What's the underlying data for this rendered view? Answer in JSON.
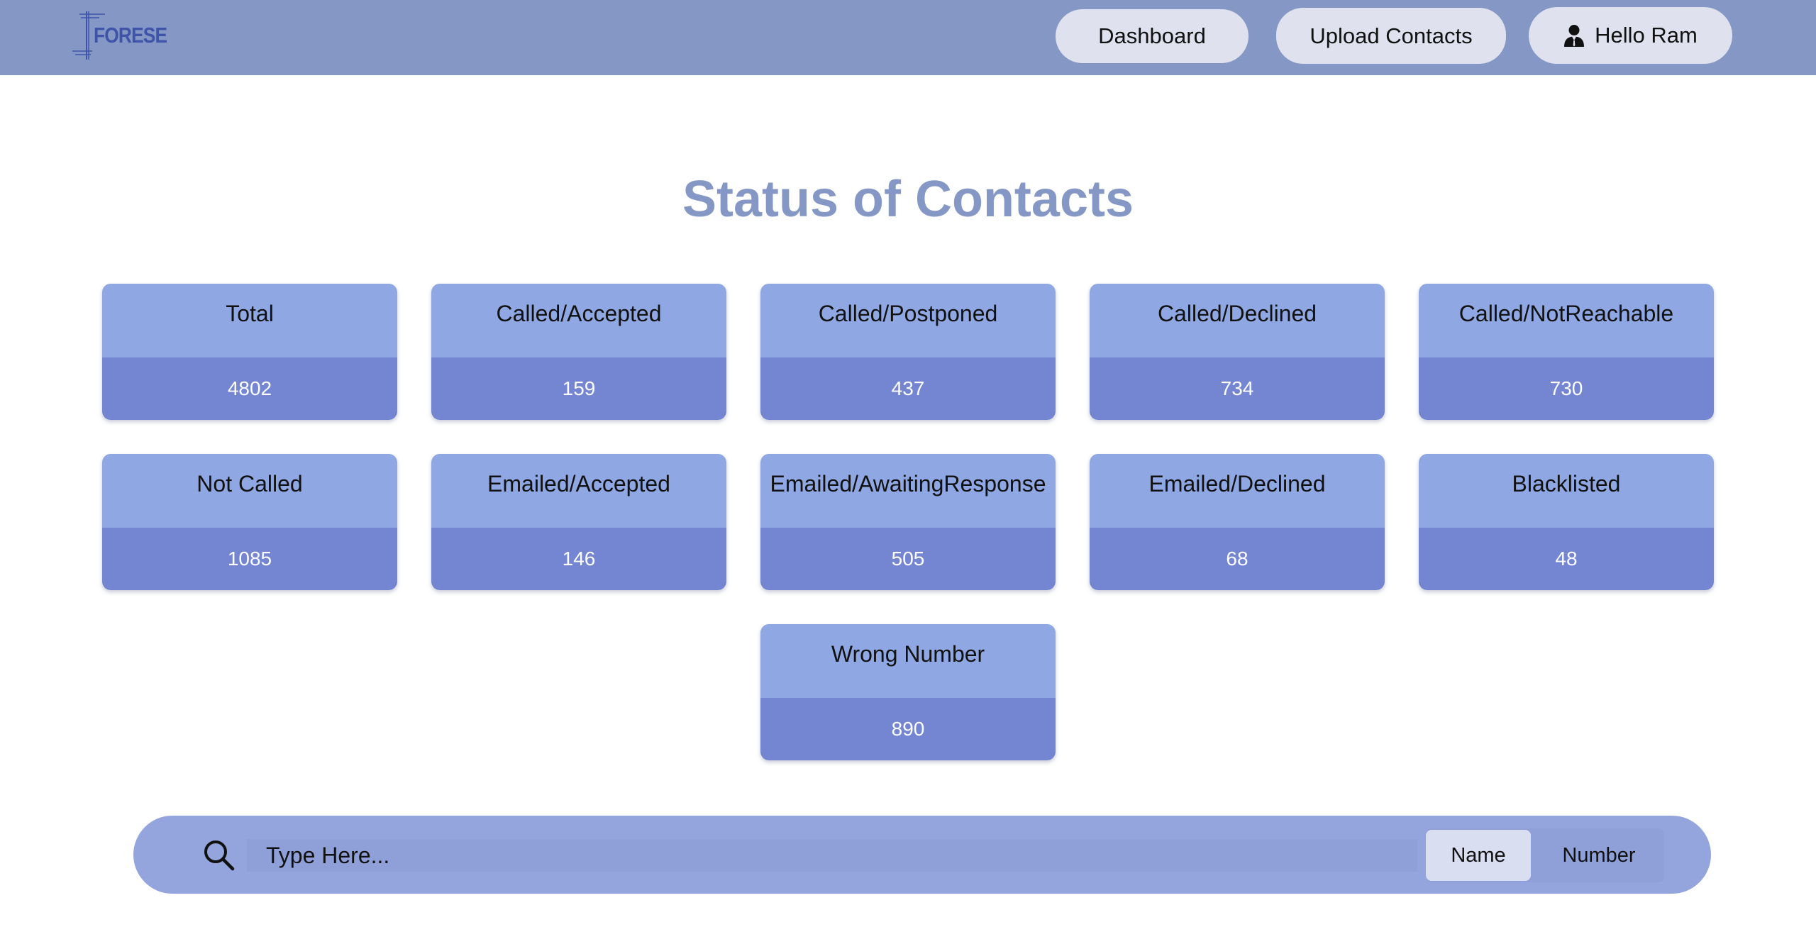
{
  "brand": {
    "logo_text": "FORESE"
  },
  "nav": {
    "dashboard_label": "Dashboard",
    "upload_label": "Upload Contacts",
    "user_label": "Hello Ram",
    "user_icon": "user-icon"
  },
  "page": {
    "title": "Status of Contacts"
  },
  "cards": [
    {
      "label": "Total",
      "value": "4802"
    },
    {
      "label": "Called/Accepted",
      "value": "159"
    },
    {
      "label": "Called/Postponed",
      "value": "437"
    },
    {
      "label": "Called/Declined",
      "value": "734"
    },
    {
      "label": "Called/NotReachable",
      "value": "730"
    },
    {
      "label": "Not Called",
      "value": "1085"
    },
    {
      "label": "Emailed/Accepted",
      "value": "146"
    },
    {
      "label": "Emailed/AwaitingResponse",
      "value": "505"
    },
    {
      "label": "Emailed/Declined",
      "value": "68"
    },
    {
      "label": "Blacklisted",
      "value": "48"
    },
    {
      "label": "Wrong Number",
      "value": "890"
    }
  ],
  "search": {
    "icon": "search-icon",
    "placeholder": "Type Here...",
    "value": "",
    "modes": [
      "Name",
      "Number"
    ],
    "selected_mode": "Name"
  },
  "colors": {
    "navbar": "#8598c5",
    "title": "#8598c5",
    "card_label_bg": "#8fa7e3",
    "card_value_bg": "#7486d2",
    "search_bar_bg": "#94a4dc",
    "button_bg": "#dfe2ee"
  }
}
